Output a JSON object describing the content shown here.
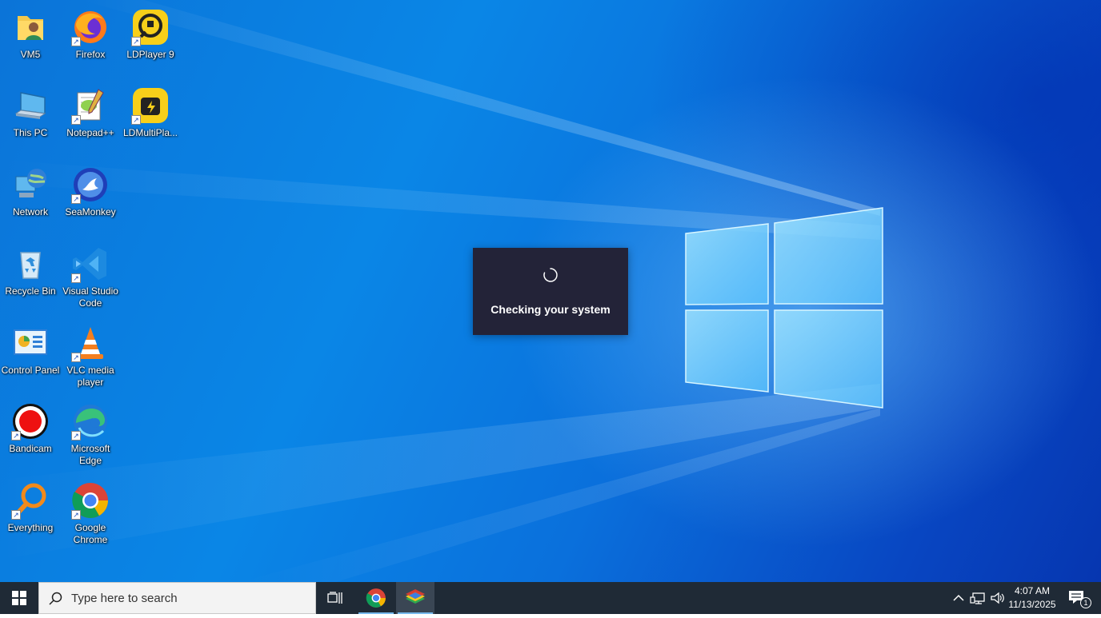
{
  "desktop_icons": [
    {
      "name": "desktop-icon-vm5",
      "label": "VM5",
      "icon": "user-folder-icon",
      "shortcut": false
    },
    {
      "name": "desktop-icon-firefox",
      "label": "Firefox",
      "icon": "firefox-icon",
      "shortcut": true
    },
    {
      "name": "desktop-icon-ldplayer9",
      "label": "LDPlayer 9",
      "icon": "ldplayer-icon",
      "shortcut": true
    },
    {
      "name": "desktop-icon-this-pc",
      "label": "This PC",
      "icon": "computer-icon",
      "shortcut": false
    },
    {
      "name": "desktop-icon-notepadpp",
      "label": "Notepad++",
      "icon": "notepadpp-icon",
      "shortcut": true
    },
    {
      "name": "desktop-icon-ldmultiplayer",
      "label": "LDMultiPla...",
      "icon": "ldmultiplayer-icon",
      "shortcut": true
    },
    {
      "name": "desktop-icon-network",
      "label": "Network",
      "icon": "network-globe-icon",
      "shortcut": false
    },
    {
      "name": "desktop-icon-seamonkey",
      "label": "SeaMonkey",
      "icon": "seamonkey-icon",
      "shortcut": true
    },
    {
      "name": "desktop-icon-recycle-bin",
      "label": "Recycle Bin",
      "icon": "recycle-bin-icon",
      "shortcut": false
    },
    {
      "name": "desktop-icon-vscode",
      "label": "Visual Studio Code",
      "icon": "vscode-icon",
      "shortcut": true
    },
    {
      "name": "desktop-icon-control-panel",
      "label": "Control Panel",
      "icon": "control-panel-icon",
      "shortcut": false
    },
    {
      "name": "desktop-icon-vlc",
      "label": "VLC media player",
      "icon": "vlc-cone-icon",
      "shortcut": true
    },
    {
      "name": "desktop-icon-bandicam",
      "label": "Bandicam",
      "icon": "bandicam-record-icon",
      "shortcut": true
    },
    {
      "name": "desktop-icon-edge",
      "label": "Microsoft Edge",
      "icon": "edge-icon",
      "shortcut": true
    },
    {
      "name": "desktop-icon-everything",
      "label": "Everything",
      "icon": "magnifier-icon",
      "shortcut": true
    },
    {
      "name": "desktop-icon-chrome",
      "label": "Google Chrome",
      "icon": "chrome-icon",
      "shortcut": true
    }
  ],
  "dialog": {
    "message": "Checking your system",
    "spinner_icon": "loading-spinner-icon"
  },
  "taskbar": {
    "search_placeholder": "Type here to search",
    "pinned": [
      {
        "name": "taskbar-task-view",
        "icon": "task-view-icon",
        "active": false
      },
      {
        "name": "taskbar-chrome",
        "icon": "chrome-icon",
        "active": false
      },
      {
        "name": "taskbar-bluestacks",
        "icon": "bluestacks-icon",
        "active": true
      }
    ],
    "tray_icons": [
      "show-hidden-icons-chevron-icon",
      "network-icon",
      "volume-icon"
    ],
    "clock_time": "4:07 AM",
    "clock_date": "11/13/2025",
    "notification_count": "1"
  },
  "colors": {
    "taskbar_bg": "#1f2a36",
    "dialog_bg": "#232338",
    "wallpaper_blue": "#0a86e6"
  }
}
